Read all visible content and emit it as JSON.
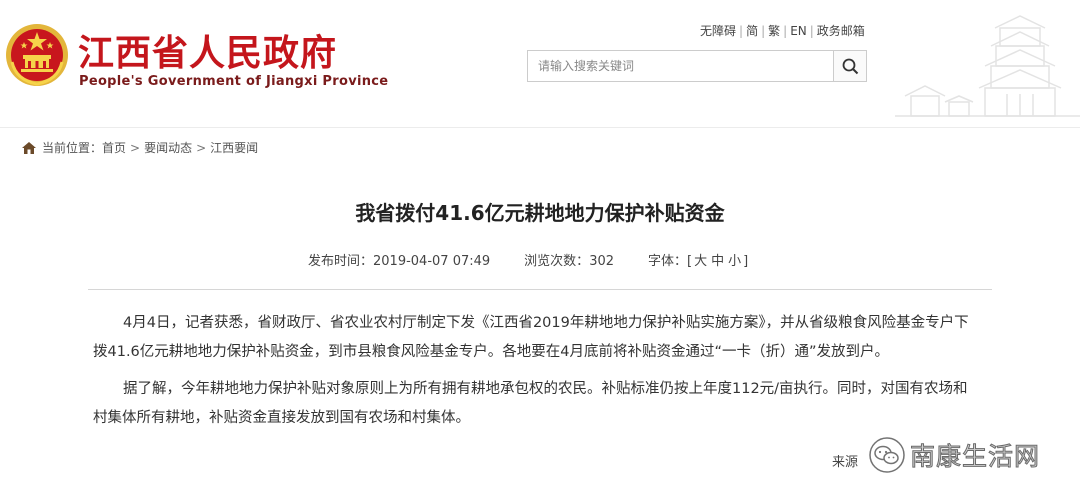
{
  "header": {
    "site_name": "江西省人民政府",
    "site_name_en": "People's Government of Jiangxi Province",
    "top_links": [
      "无障碍",
      "简",
      "繁",
      "EN",
      "政务邮箱"
    ],
    "search_placeholder": "请输入搜索关键词"
  },
  "breadcrumb": {
    "prefix": "当前位置：",
    "items": [
      "首页",
      "要闻动态",
      "江西要闻"
    ]
  },
  "article": {
    "title": "我省拨付41.6亿元耕地地力保护补贴资金",
    "publish_label": "发布时间：",
    "publish_time": "2019-04-07 07:49",
    "views_label": "浏览次数：",
    "views": "302",
    "font_label": "字体：",
    "font_open": "[",
    "font_large": "大",
    "font_medium": "中",
    "font_small": "小",
    "font_close": "]",
    "paragraphs": [
      "4月4日，记者获悉，省财政厅、省农业农村厅制定下发《江西省2019年耕地地力保护补贴实施方案》，并从省级粮食风险基金专户下拨41.6亿元耕地地力保护补贴资金，到市县粮食风险基金专户。各地要在4月底前将补贴资金通过“一卡（折）通”发放到户。",
      "据了解，今年耕地地力保护补贴对象原则上为所有拥有耕地承包权的农民。补贴标准仍按上年度112元/亩执行。同时，对国有农场和村集体所有耕地，补贴资金直接发放到国有农场和村集体。"
    ],
    "source_label": "来源"
  },
  "watermark": {
    "text": "南康生活网"
  },
  "colors": {
    "brand_red": "#c4161c",
    "emblem_gold": "#e3b63b"
  }
}
